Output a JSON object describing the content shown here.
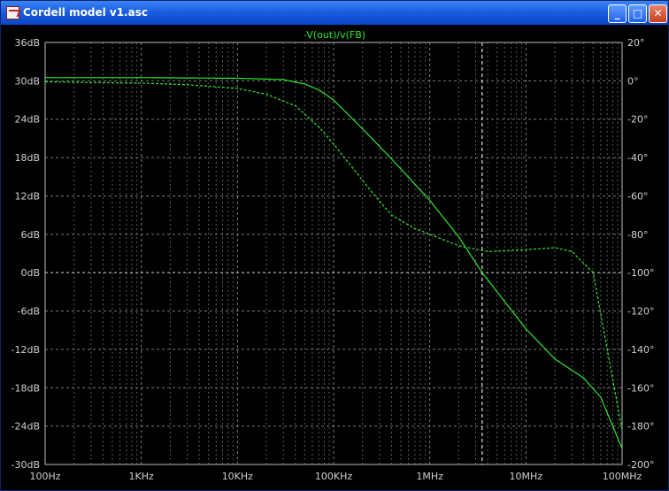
{
  "window": {
    "title": "Cordell model v1.asc",
    "minimize_label": "_",
    "maximize_label": "□",
    "close_label": "✕"
  },
  "colors": {
    "trace": "#2ee82e",
    "grid": "#5a5a5a",
    "axis_text": "#cfcfcf"
  },
  "chart_data": {
    "type": "line",
    "title": "-V(out)/v(FB)",
    "x_scale": "log",
    "xlim": [
      100,
      100000000
    ],
    "x_tick_labels": [
      "100Hz",
      "1KHz",
      "10KHz",
      "100KHz",
      "1MHz",
      "10MHz",
      "100MHz"
    ],
    "x_ticks": [
      100,
      1000,
      10000,
      100000,
      1000000,
      10000000,
      100000000
    ],
    "ylim": [
      -30,
      36
    ],
    "y_ticks": [
      -30,
      -24,
      -18,
      -12,
      -6,
      0,
      6,
      12,
      18,
      24,
      30,
      36
    ],
    "y_tick_labels": [
      "-30dB",
      "-24dB",
      "-18dB",
      "-12dB",
      "-6dB",
      "0dB",
      "6dB",
      "12dB",
      "18dB",
      "24dB",
      "30dB",
      "36dB"
    ],
    "y2lim": [
      -200,
      20
    ],
    "y2_ticks": [
      -200,
      -180,
      -160,
      -140,
      -120,
      -100,
      -80,
      -60,
      -40,
      -20,
      0,
      20
    ],
    "y2_tick_labels": [
      "-200°",
      "-180°",
      "-160°",
      "-140°",
      "-120°",
      "-100°",
      "-80°",
      "-60°",
      "-40°",
      "-20°",
      "0°",
      "20°"
    ],
    "grid": true,
    "cursor_x": 3500000,
    "reference_y": 0,
    "series": [
      {
        "axis": "left",
        "style": "solid",
        "points": [
          [
            100,
            30.5
          ],
          [
            1000,
            30.5
          ],
          [
            10000,
            30.4
          ],
          [
            30000,
            30.2
          ],
          [
            50000,
            29.5
          ],
          [
            70000,
            28.6
          ],
          [
            100000,
            27
          ],
          [
            200000,
            22.5
          ],
          [
            400000,
            17.8
          ],
          [
            1000000,
            11.3
          ],
          [
            2000000,
            5.6
          ],
          [
            3500000,
            0
          ],
          [
            6000000,
            -4.5
          ],
          [
            10000000,
            -8.8
          ],
          [
            20000000,
            -13.5
          ],
          [
            40000000,
            -16.5
          ],
          [
            60000000,
            -19.5
          ],
          [
            100000000,
            -27.5
          ]
        ]
      },
      {
        "axis": "right",
        "style": "dashed",
        "points": [
          [
            100,
            -0.5
          ],
          [
            1000,
            -1.2
          ],
          [
            3000,
            -2
          ],
          [
            10000,
            -4
          ],
          [
            20000,
            -7
          ],
          [
            40000,
            -13
          ],
          [
            70000,
            -24
          ],
          [
            100000,
            -33
          ],
          [
            150000,
            -44
          ],
          [
            250000,
            -58
          ],
          [
            400000,
            -70
          ],
          [
            700000,
            -77
          ],
          [
            1000000,
            -80
          ],
          [
            2000000,
            -86
          ],
          [
            4000000,
            -89
          ],
          [
            10000000,
            -88
          ],
          [
            20000000,
            -87
          ],
          [
            30000000,
            -89
          ],
          [
            50000000,
            -100
          ],
          [
            70000000,
            -140
          ],
          [
            100000000,
            -182
          ]
        ]
      }
    ]
  }
}
